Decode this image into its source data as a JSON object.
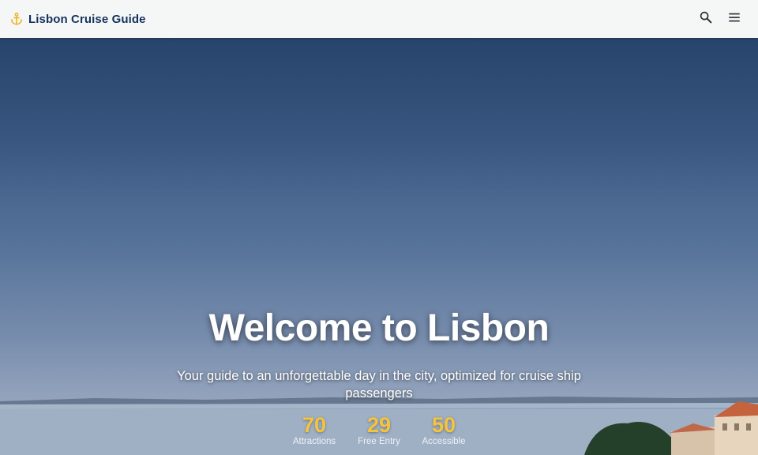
{
  "header": {
    "brand_title": "Lisbon Cruise Guide",
    "brand_icon": "anchor-icon",
    "actions": [
      {
        "name": "search",
        "icon": "search-icon"
      },
      {
        "name": "menu",
        "icon": "menu-icon"
      }
    ]
  },
  "hero": {
    "title": "Welcome to Lisbon",
    "subtitle": "Your guide to an unforgettable day in the city, optimized for cruise ship passengers",
    "stats": [
      {
        "value": "70",
        "label": "Attractions"
      },
      {
        "value": "29",
        "label": "Free Entry"
      },
      {
        "value": "50",
        "label": "Accessible"
      }
    ]
  },
  "colors": {
    "brand": "#16325c",
    "accent": "#f5c43b",
    "header_bg": "#f5f7f7"
  }
}
